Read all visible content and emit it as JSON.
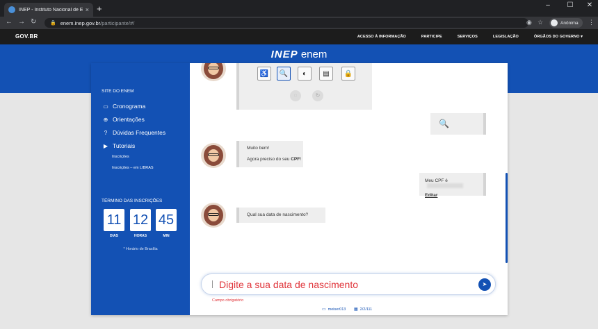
{
  "browser": {
    "tab_title": "INEP - Instituto Nacional de Est...",
    "tab_close": "×",
    "new_tab": "+",
    "controls": [
      "–",
      "☐",
      "✕"
    ],
    "url_host": "enem.inep.gov.br",
    "url_path": "/participante/#/",
    "profile": "Anônima"
  },
  "gov": {
    "logo": "GOV.BR",
    "links": [
      "ACESSO À INFORMAÇÃO",
      "PARTICIPE",
      "SERVIÇOS",
      "LEGISLAÇÃO",
      "ÓRGÃOS DO GOVERNO ▾"
    ]
  },
  "brand": {
    "inep": "INEP",
    "enem": "enem"
  },
  "sidebar": {
    "title": "SITE DO ENEM",
    "items": [
      {
        "icon": "calendar-icon",
        "glyph": "▭",
        "label": "Cronograma"
      },
      {
        "icon": "globe-icon",
        "glyph": "⊕",
        "label": "Orientações"
      },
      {
        "icon": "question-icon",
        "glyph": "?",
        "label": "Dúvidas Frequentes"
      },
      {
        "icon": "video-icon",
        "glyph": "▶",
        "label": "Tutoriais"
      }
    ],
    "subitems": [
      "Inscrições",
      "Inscrições – em LIBRAS"
    ],
    "term_title": "TÉRMINO DAS INSCRIÇÕES",
    "countdown": [
      {
        "value": "11",
        "label": "DIAS"
      },
      {
        "value": "12",
        "label": "HORAS"
      },
      {
        "value": "45",
        "label": "MIN"
      }
    ],
    "note": "* Horário de Brasília"
  },
  "chat": {
    "tools": [
      "♿",
      "🔍",
      "◐",
      "▤",
      "🔒"
    ],
    "mini_buttons": [
      "◌",
      "↻"
    ],
    "user_search_glyph": "🔍",
    "bot_msg1_line1": "Muito bem!",
    "bot_msg1_line2_prefix": "Agora preciso do seu ",
    "bot_msg1_line2_bold": "CPF",
    "bot_msg1_line2_suffix": "!",
    "user_cpf_label": "Meu CPF é",
    "user_cpf_edit": "Editar",
    "bot_msg2": "Qual sua data de nascimento?",
    "input_placeholder": "Digite a sua data de nascimento",
    "send_glyph": "➤",
    "error": "Campo obrigatório",
    "footer_left": "meiser013",
    "footer_right": "2/2/111"
  },
  "colors": {
    "brand_blue": "#1351b4",
    "error_red": "#e0343a"
  }
}
